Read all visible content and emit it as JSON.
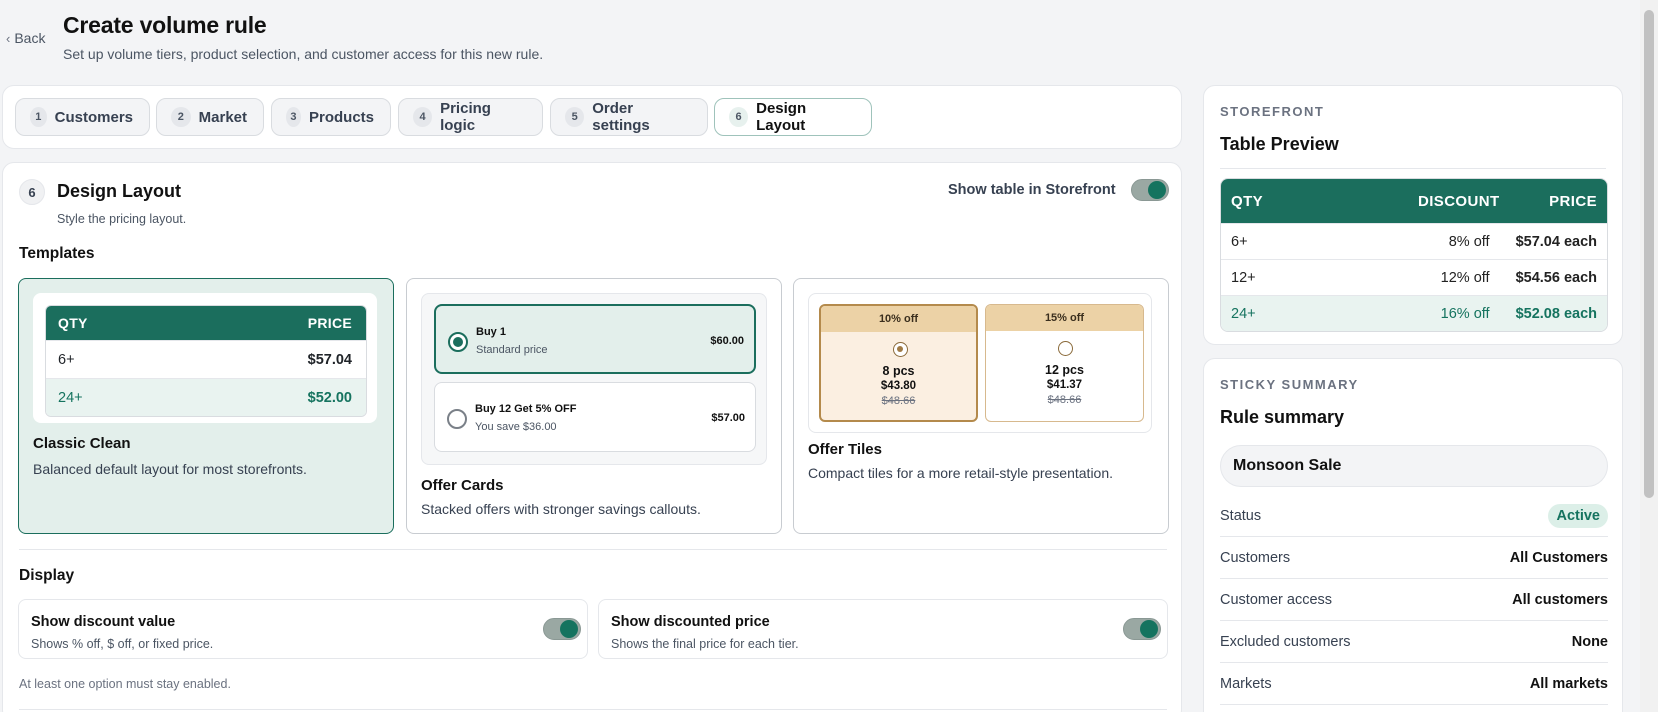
{
  "header": {
    "back_label": "Back",
    "title": "Create volume rule",
    "subtitle": "Set up volume tiers, product selection, and customer access for this new rule."
  },
  "tabs": [
    {
      "num": "1",
      "label": "Customers"
    },
    {
      "num": "2",
      "label": "Market"
    },
    {
      "num": "3",
      "label": "Products"
    },
    {
      "num": "4",
      "label": "Pricing logic"
    },
    {
      "num": "5",
      "label": "Order settings"
    },
    {
      "num": "6",
      "label": "Design Layout"
    }
  ],
  "active_tab": 6,
  "section": {
    "num": "6",
    "title": "Design Layout",
    "subtitle": "Style the pricing layout.",
    "storefront_toggle_label": "Show table in Storefront",
    "storefront_toggle_on": true
  },
  "templates": {
    "heading": "Templates",
    "classic": {
      "name": "Classic Clean",
      "desc": "Balanced default layout for most storefronts.",
      "head_qty": "QTY",
      "head_price": "PRICE",
      "rows": [
        {
          "qty": "6+",
          "price": "$57.04"
        },
        {
          "qty": "24+",
          "price": "$52.00"
        }
      ]
    },
    "offer_cards": {
      "name": "Offer Cards",
      "desc": "Stacked offers with stronger savings callouts.",
      "options": [
        {
          "title": "Buy 1",
          "sub": "Standard price",
          "price": "$60.00"
        },
        {
          "title": "Buy 12 Get 5% OFF",
          "sub": "You save $36.00",
          "price": "$57.00"
        }
      ]
    },
    "offer_tiles": {
      "name": "Offer Tiles",
      "desc": "Compact tiles for a more retail-style presentation.",
      "tiles": [
        {
          "badge": "10% off",
          "pcs": "8 pcs",
          "price": "$43.80",
          "old": "$48.66"
        },
        {
          "badge": "15% off",
          "pcs": "12 pcs",
          "price": "$41.37",
          "old": "$48.66"
        }
      ]
    }
  },
  "display": {
    "heading": "Display",
    "options": [
      {
        "title": "Show discount value",
        "desc": "Shows % off, $ off, or fixed price.",
        "on": true
      },
      {
        "title": "Show discounted price",
        "desc": "Shows the final price for each tier.",
        "on": true
      }
    ],
    "hint": "At least one option must stay enabled."
  },
  "preview": {
    "kicker": "STOREFRONT",
    "title": "Table Preview",
    "head": {
      "qty": "QTY",
      "discount": "DISCOUNT",
      "price": "PRICE"
    },
    "rows": [
      {
        "qty": "6+",
        "discount": "8% off",
        "price": "$57.04 each"
      },
      {
        "qty": "12+",
        "discount": "12% off",
        "price": "$54.56 each"
      },
      {
        "qty": "24+",
        "discount": "16% off",
        "price": "$52.08 each"
      }
    ]
  },
  "summary": {
    "kicker": "STICKY SUMMARY",
    "title": "Rule summary",
    "rule_name": "Monsoon Sale",
    "rows": [
      {
        "key": "Status",
        "value": "Active"
      },
      {
        "key": "Customers",
        "value": "All Customers"
      },
      {
        "key": "Customer access",
        "value": "All customers"
      },
      {
        "key": "Excluded customers",
        "value": "None"
      },
      {
        "key": "Markets",
        "value": "All markets"
      }
    ]
  },
  "colors": {
    "accent": "#1b6e5d",
    "accent_light": "#e3efeb",
    "tile_badge": "#ecd2a6"
  }
}
